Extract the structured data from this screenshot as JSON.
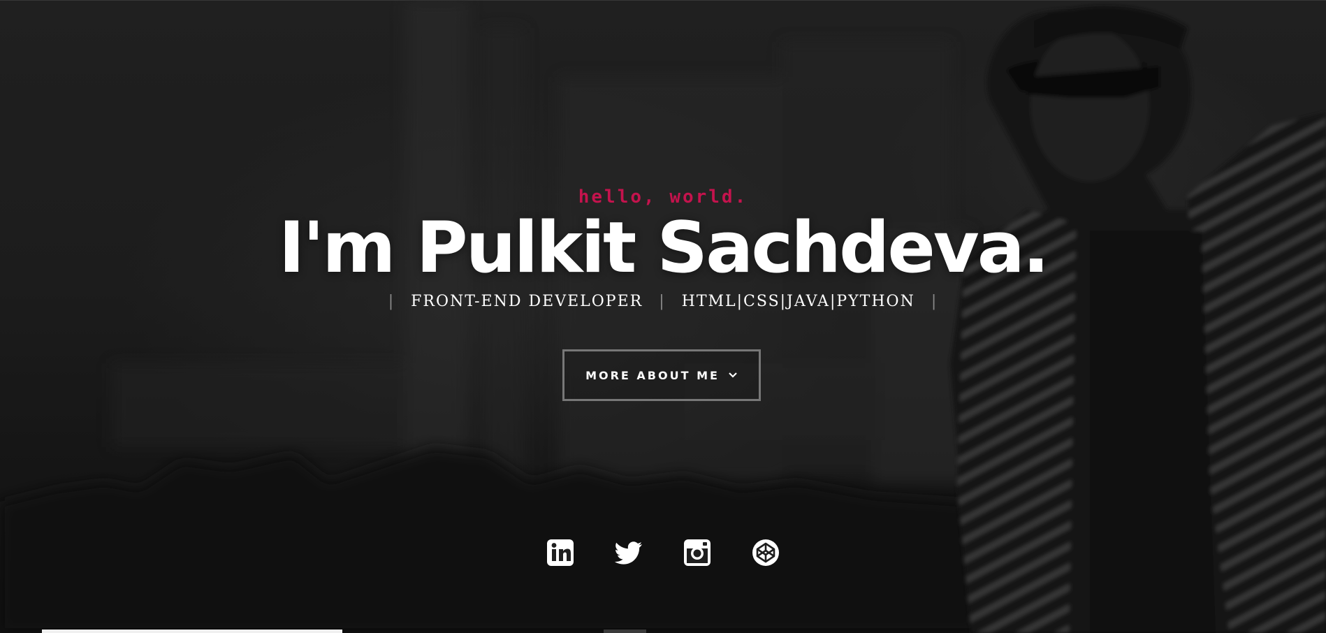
{
  "hero": {
    "pretitle": "hello, world.",
    "name": "I'm Pulkit Sachdeva.",
    "roles": [
      "FRONT-END DEVELOPER",
      "HTML|CSS|JAVA|PYTHON"
    ],
    "separator": "|",
    "cta_label": "MORE ABOUT ME",
    "cta_icon": "chevron-down-icon"
  },
  "social": {
    "items": [
      {
        "name": "linkedin-icon"
      },
      {
        "name": "twitter-icon"
      },
      {
        "name": "instagram-icon"
      },
      {
        "name": "codepen-icon"
      }
    ]
  },
  "colors": {
    "accent": "#c4134d",
    "text": "#ffffff",
    "background": "#262626",
    "button_border": "#777777"
  }
}
